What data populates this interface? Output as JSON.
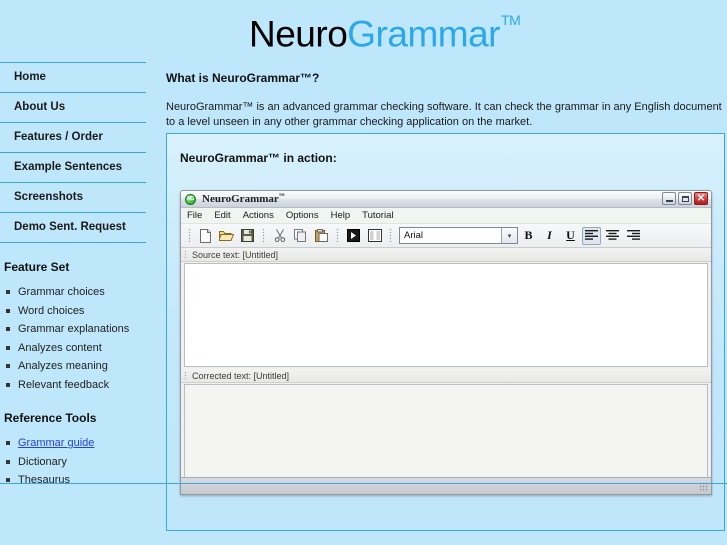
{
  "site": {
    "logo_primary": "Neuro",
    "logo_secondary": "Grammar",
    "logo_tm": "TM"
  },
  "sidebar": {
    "nav": [
      {
        "label": "Home"
      },
      {
        "label": "About Us"
      },
      {
        "label": "Features / Order"
      },
      {
        "label": "Example Sentences"
      },
      {
        "label": "Screenshots"
      },
      {
        "label": "Demo Sent. Request"
      }
    ],
    "feature_set": {
      "title": "Feature Set",
      "items": [
        "Grammar choices",
        "Word choices",
        "Grammar explanations",
        "Analyzes content",
        "Analyzes meaning",
        "Relevant feedback"
      ]
    },
    "reference_tools": {
      "title": "Reference Tools",
      "items": [
        {
          "label": "Grammar guide",
          "link": true
        },
        {
          "label": "Dictionary",
          "link": false
        },
        {
          "label": "Thesaurus",
          "link": false
        }
      ]
    }
  },
  "main": {
    "heading": "What is NeuroGrammar™?",
    "paragraph": "NeuroGrammar™ is an advanced grammar checking software. It can check the grammar in any English document to a level unseen in any other grammar checking application on the market.",
    "demo_title": "NeuroGrammar™ in action:"
  },
  "app": {
    "icon_label": "NG",
    "title": "NeuroGrammar",
    "title_tm": "™",
    "menus": [
      "File",
      "Edit",
      "Actions",
      "Options",
      "Help",
      "Tutorial"
    ],
    "window_controls": {
      "minimize": "minimize-icon",
      "maximize": "maximize-icon",
      "close": "✕"
    },
    "toolbar": {
      "icons": [
        "new-document-icon",
        "open-folder-icon",
        "save-icon",
        "cut-icon",
        "copy-icon",
        "paste-icon",
        "check-grammar-icon",
        "split-view-icon"
      ],
      "font_value": "Arial",
      "font_arrow": "▾",
      "bold": "B",
      "italic": "I",
      "underline": "U",
      "align_icons": [
        "align-left-icon",
        "align-center-icon",
        "align-right-icon"
      ]
    },
    "panes": {
      "source_label": "Source text: [Untitled]",
      "source_value": "",
      "corrected_label": "Corrected text: [Untitled]",
      "corrected_value": ""
    }
  },
  "colors": {
    "page_bg": "#bfe7fb",
    "accent_blue": "#29a8ec",
    "rule_blue": "#3aa8e0",
    "link_blue": "#2244dd"
  }
}
